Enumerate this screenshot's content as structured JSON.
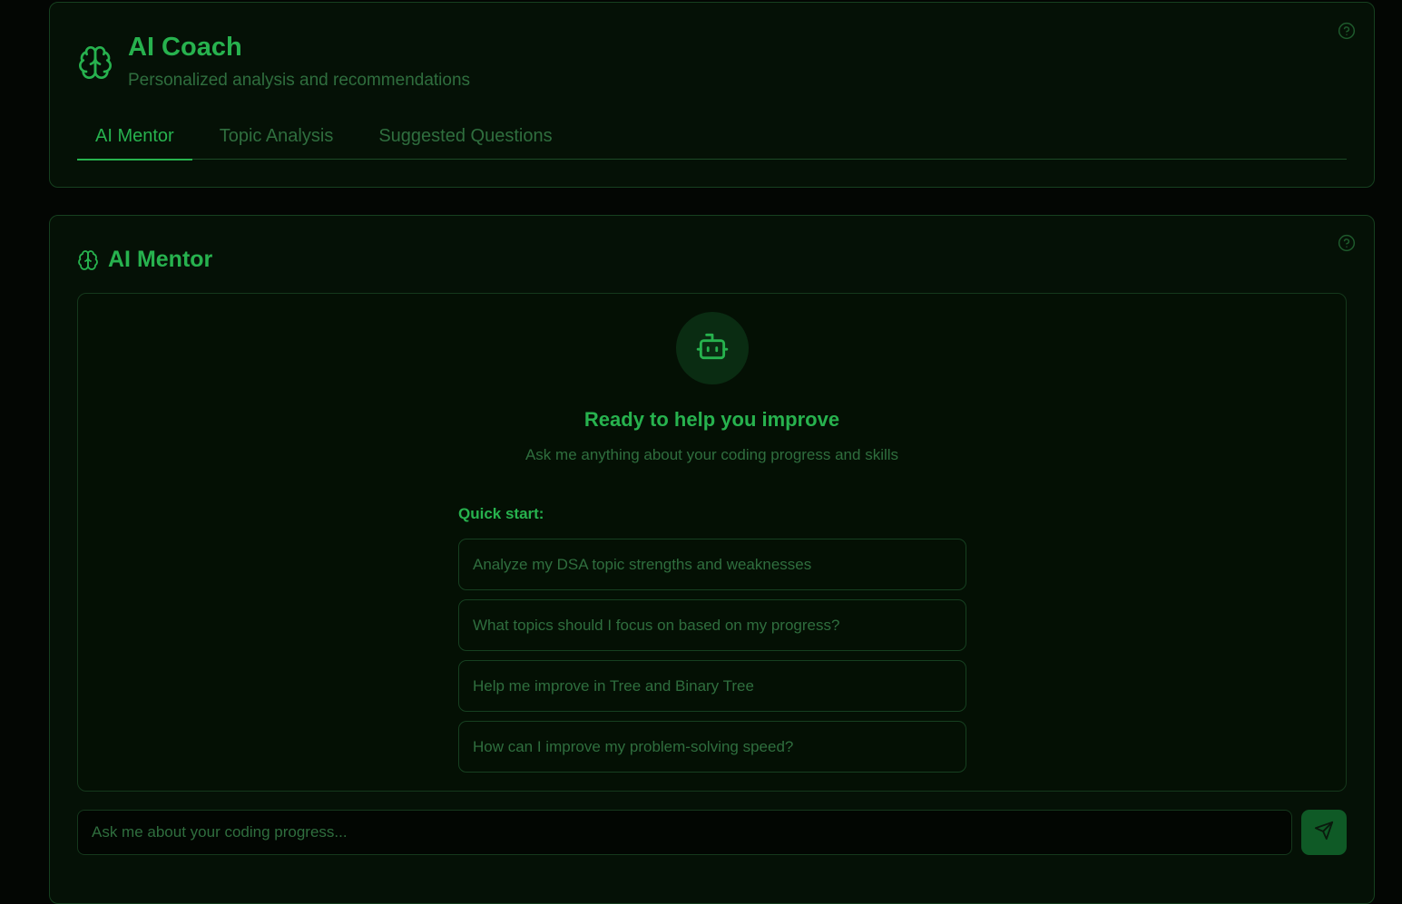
{
  "header": {
    "title": "AI Coach",
    "subtitle": "Personalized analysis and recommendations",
    "tabs": [
      {
        "label": "AI Mentor",
        "active": true
      },
      {
        "label": "Topic Analysis",
        "active": false
      },
      {
        "label": "Suggested Questions",
        "active": false
      }
    ]
  },
  "mentor": {
    "title": "AI Mentor",
    "empty_state": {
      "title": "Ready to help you improve",
      "subtitle": "Ask me anything about your coding progress and skills"
    },
    "quick_start": {
      "label": "Quick start:",
      "items": [
        "Analyze my DSA topic strengths and weaknesses",
        "What topics should I focus on based on my progress?",
        "Help me improve in Tree and Binary Tree",
        "How can I improve my problem-solving speed?"
      ]
    },
    "input": {
      "placeholder": "Ask me about your coding progress...",
      "value": ""
    }
  },
  "icons": {
    "header": "brain-icon",
    "mentor": "brain-icon",
    "help": "help-circle-icon",
    "bot": "bot-icon",
    "send": "send-icon"
  },
  "colors": {
    "accent": "#27b24e",
    "muted_text": "#2f6e3e",
    "card_bg": "#051106",
    "border": "#16401f",
    "send_button": "#0f5a26"
  }
}
